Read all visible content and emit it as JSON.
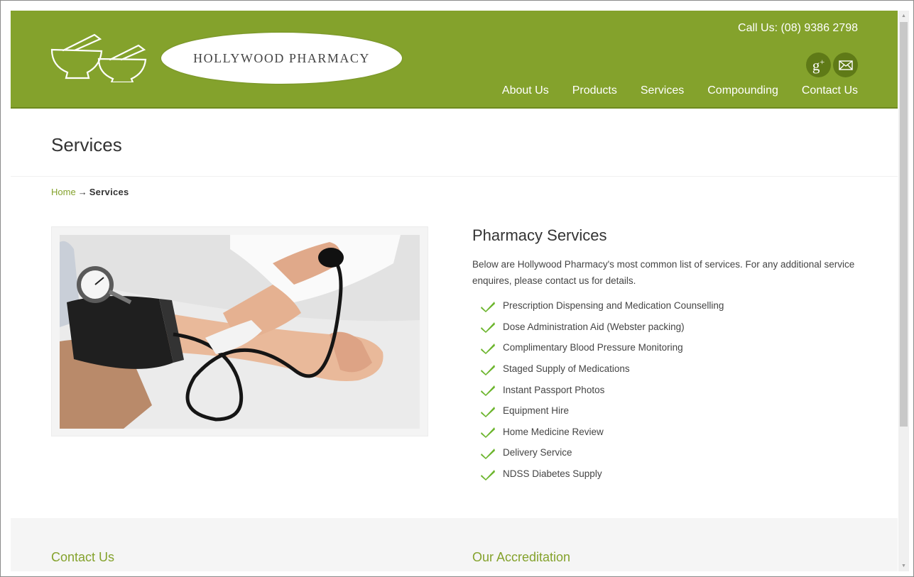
{
  "header": {
    "logo_text": "HOLLYWOOD PHARMACY",
    "call_us": "Call Us: (08) 9386 2798",
    "social": {
      "gplus_label": "g",
      "gplus_sup": "+"
    },
    "nav": [
      {
        "label": "About Us"
      },
      {
        "label": "Products"
      },
      {
        "label": "Services"
      },
      {
        "label": "Compounding"
      },
      {
        "label": "Contact Us"
      }
    ]
  },
  "page_title": "Services",
  "breadcrumb": {
    "home": "Home",
    "separator": "→",
    "current": "Services"
  },
  "main": {
    "heading": "Pharmacy Services",
    "intro": "Below are Hollywood Pharmacy's most common list of services. For any additional service enquires, please contact us for details.",
    "services": [
      "Prescription Dispensing and Medication Counselling",
      "Dose Administration Aid (Webster packing)",
      "Complimentary Blood Pressure Monitoring",
      "Staged Supply of Medications",
      "Instant Passport Photos",
      "Equipment Hire",
      "Home Medicine Review",
      "Delivery Service",
      "NDSS Diabetes Supply"
    ]
  },
  "footer": {
    "contact_heading": "Contact Us",
    "accreditation_heading": "Our Accreditation"
  },
  "colors": {
    "brand_green": "#84a22c",
    "dark_green": "#5f7a17",
    "check_green": "#6cb52d"
  },
  "icons": {
    "logo": "mortar-pestle-icon",
    "social_1": "google-plus-icon",
    "social_2": "envelope-icon",
    "list_bullet": "check-icon"
  }
}
